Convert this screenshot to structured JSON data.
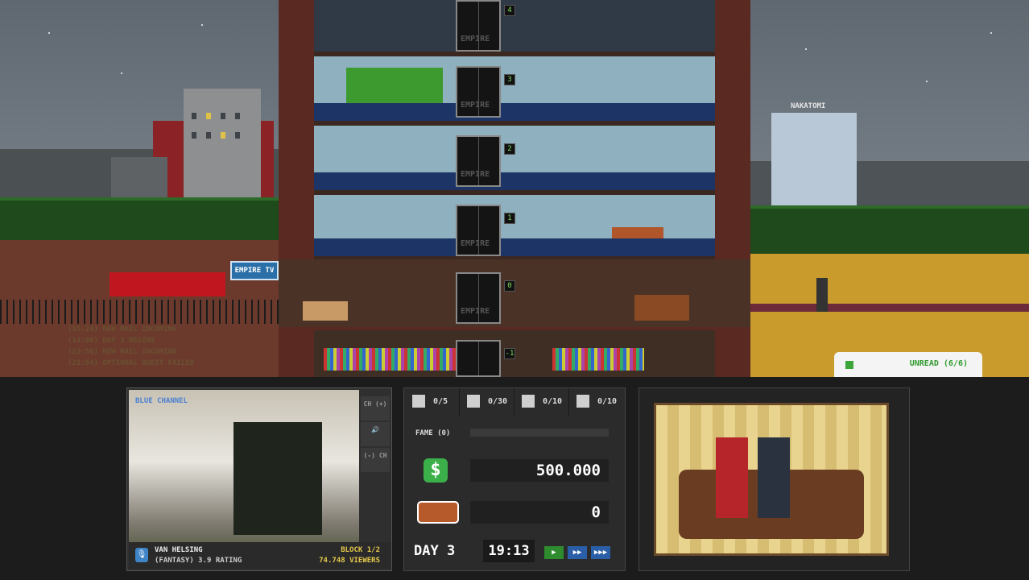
{
  "scene": {
    "log": [
      "(15:24) NEW MAIL INCOMING",
      "(14:00) DAY 3 BEGINS",
      "(23:56) NEW MAIL INCOMING",
      "(21:54) OPTIONAL QUEST FAILED"
    ],
    "signs": {
      "empire_tv": "EMPIRE TV",
      "nakatomi": "NAKATOMI"
    },
    "floors": [
      "4",
      "3",
      "2",
      "1",
      "0",
      "-1"
    ],
    "elevator_label": "EMPIRE",
    "unread": "UNREAD (6/6)"
  },
  "tv": {
    "channel": "BLUE CHANNEL",
    "show": "VAN HELSING",
    "genre_rating": "(FANTASY) 3.9 RATING",
    "block": "BLOCK 1/2",
    "viewers": "74.748 VIEWERS",
    "buttons": [
      "CH (+)",
      "🔊",
      "(-) CH"
    ]
  },
  "resources": [
    {
      "icon": "clipboard-icon",
      "value": "0/5"
    },
    {
      "icon": "clapperboard-icon",
      "value": "0/30"
    },
    {
      "icon": "megaphone-icon",
      "value": "0/10"
    },
    {
      "icon": "megaphone-icon",
      "value": "0/10"
    }
  ],
  "fame": {
    "label": "FAME (0)",
    "progress": 0
  },
  "money": "500.000",
  "couch": "0",
  "clock": {
    "day": "DAY 3",
    "time": "19:13"
  },
  "colors": {
    "accent_green": "#3bb04a",
    "hud_bg": "#1c1c1c",
    "viewers_yellow": "#e6c94b"
  }
}
